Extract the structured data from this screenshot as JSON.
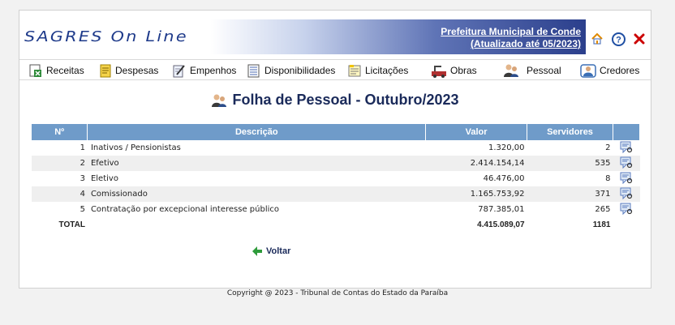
{
  "header": {
    "logo_text": "SAGRES On Line",
    "org_name": "Prefeitura Municipal de Conde",
    "updated": "(Atualizado até 05/2023)"
  },
  "header_icons": [
    "home-icon",
    "help-icon",
    "close-icon"
  ],
  "nav": {
    "items": [
      {
        "label": "Receitas",
        "icon": "receitas-icon"
      },
      {
        "label": "Despesas",
        "icon": "despesas-icon"
      },
      {
        "label": "Empenhos",
        "icon": "empenhos-icon"
      },
      {
        "label": "Disponibilidades",
        "icon": "disponibilidades-icon"
      },
      {
        "label": "Licitações",
        "icon": "licitacoes-icon"
      },
      {
        "label": "Obras",
        "icon": "obras-icon"
      },
      {
        "label": "Pessoal",
        "icon": "pessoal-icon"
      },
      {
        "label": "Credores",
        "icon": "credores-icon"
      }
    ]
  },
  "page_title": "Folha de Pessoal - Outubro/2023",
  "table": {
    "headers": {
      "num": "Nº",
      "desc": "Descrição",
      "valor": "Valor",
      "servidores": "Servidores"
    },
    "rows": [
      {
        "num": "1",
        "desc": "Inativos / Pensionistas",
        "valor": "1.320,00",
        "servidores": "2"
      },
      {
        "num": "2",
        "desc": "Efetivo",
        "valor": "2.414.154,14",
        "servidores": "535"
      },
      {
        "num": "3",
        "desc": "Eletivo",
        "valor": "46.476,00",
        "servidores": "8"
      },
      {
        "num": "4",
        "desc": "Comissionado",
        "valor": "1.165.753,92",
        "servidores": "371"
      },
      {
        "num": "5",
        "desc": "Contratação por excepcional interesse público",
        "valor": "787.385,01",
        "servidores": "265"
      }
    ],
    "total": {
      "label": "TOTAL",
      "valor": "4.415.089,07",
      "servidores": "1181"
    }
  },
  "voltar_label": "Voltar",
  "footer": "Copyright @ 2023 - Tribunal de Contas do Estado da Paraíba",
  "colors": {
    "header_blue": "#2b3f8c",
    "table_header": "#6f9bc9",
    "close_red": "#cc0000"
  }
}
